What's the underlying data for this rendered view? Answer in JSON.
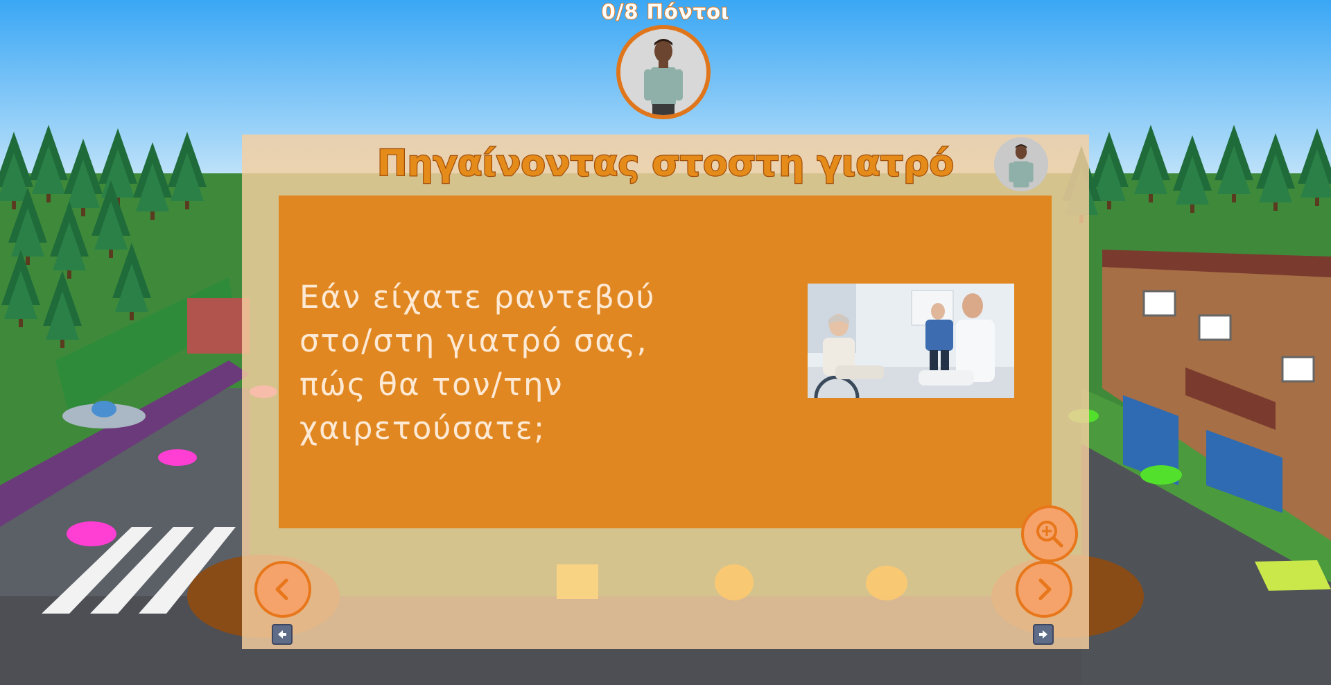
{
  "score": {
    "text": "0/8 Πόντοι"
  },
  "dialog": {
    "title": "Πηγαίνοντας στοστη γιατρό",
    "question": "Εάν είχατε ραντεβού στο/στη γιατρό σας, πώς θα τον/την χαιρετούσατε;"
  },
  "buttons": {
    "zoom_icon": "zoom-in-icon",
    "prev_icon": "chevron-left-icon",
    "next_icon": "chevron-right-icon",
    "zoom_key_icon": "arrow-up-key-icon",
    "prev_key_icon": "arrow-left-key-icon",
    "next_key_icon": "arrow-right-key-icon"
  },
  "colors": {
    "accent_orange": "#e08721",
    "panel": "#f6d0a0",
    "sky": "#45aef5",
    "button_fill": "#f5a36a"
  }
}
